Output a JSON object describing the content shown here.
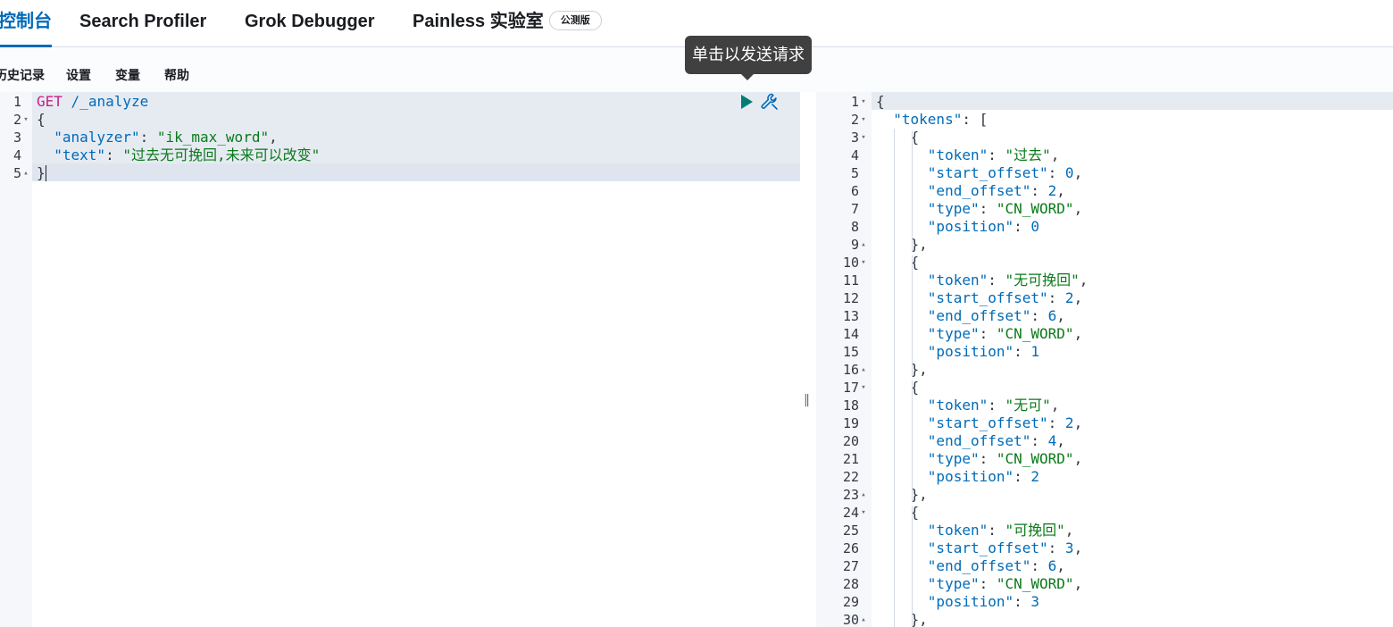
{
  "tabs": [
    {
      "label": "控制台",
      "active": true
    },
    {
      "label": "Search Profiler"
    },
    {
      "label": "Grok Debugger"
    },
    {
      "label": "Painless 实验室",
      "badge": "公测版"
    }
  ],
  "submenu": [
    "历史记录",
    "设置",
    "变量",
    "帮助"
  ],
  "tooltip": "单击以发送请求",
  "request": {
    "lines": [
      {
        "n": "1",
        "fold": "",
        "tokens": [
          [
            "method",
            "GET"
          ],
          [
            "text",
            " "
          ],
          [
            "path",
            "/_analyze"
          ]
        ]
      },
      {
        "n": "2",
        "fold": "▾",
        "tokens": [
          [
            "punc",
            "{"
          ]
        ]
      },
      {
        "n": "3",
        "fold": "",
        "tokens": [
          [
            "text",
            "  "
          ],
          [
            "key",
            "\"analyzer\""
          ],
          [
            "punc",
            ": "
          ],
          [
            "str",
            "\"ik_max_word\""
          ],
          [
            "punc",
            ","
          ]
        ]
      },
      {
        "n": "4",
        "fold": "",
        "tokens": [
          [
            "text",
            "  "
          ],
          [
            "key",
            "\"text\""
          ],
          [
            "punc",
            ": "
          ],
          [
            "str",
            "\"过去无可挽回,未来可以改变\""
          ]
        ]
      },
      {
        "n": "5",
        "fold": "▴",
        "tokens": [
          [
            "punc",
            "}"
          ]
        ]
      }
    ]
  },
  "response": {
    "lines": [
      {
        "n": "1",
        "fold": "▾",
        "tokens": [
          [
            "punc",
            "{"
          ]
        ]
      },
      {
        "n": "2",
        "fold": "▾",
        "tokens": [
          [
            "text",
            "  "
          ],
          [
            "key",
            "\"tokens\""
          ],
          [
            "punc",
            ": ["
          ]
        ]
      },
      {
        "n": "3",
        "fold": "▾",
        "tokens": [
          [
            "text",
            "    "
          ],
          [
            "punc",
            "{"
          ]
        ]
      },
      {
        "n": "4",
        "fold": "",
        "tokens": [
          [
            "text",
            "      "
          ],
          [
            "key",
            "\"token\""
          ],
          [
            "punc",
            ": "
          ],
          [
            "str",
            "\"过去\""
          ],
          [
            "punc",
            ","
          ]
        ]
      },
      {
        "n": "5",
        "fold": "",
        "tokens": [
          [
            "text",
            "      "
          ],
          [
            "key",
            "\"start_offset\""
          ],
          [
            "punc",
            ": "
          ],
          [
            "num",
            "0"
          ],
          [
            "punc",
            ","
          ]
        ]
      },
      {
        "n": "6",
        "fold": "",
        "tokens": [
          [
            "text",
            "      "
          ],
          [
            "key",
            "\"end_offset\""
          ],
          [
            "punc",
            ": "
          ],
          [
            "num",
            "2"
          ],
          [
            "punc",
            ","
          ]
        ]
      },
      {
        "n": "7",
        "fold": "",
        "tokens": [
          [
            "text",
            "      "
          ],
          [
            "key",
            "\"type\""
          ],
          [
            "punc",
            ": "
          ],
          [
            "str",
            "\"CN_WORD\""
          ],
          [
            "punc",
            ","
          ]
        ]
      },
      {
        "n": "8",
        "fold": "",
        "tokens": [
          [
            "text",
            "      "
          ],
          [
            "key",
            "\"position\""
          ],
          [
            "punc",
            ": "
          ],
          [
            "num",
            "0"
          ]
        ]
      },
      {
        "n": "9",
        "fold": "▴",
        "tokens": [
          [
            "text",
            "    "
          ],
          [
            "punc",
            "},"
          ]
        ]
      },
      {
        "n": "10",
        "fold": "▾",
        "tokens": [
          [
            "text",
            "    "
          ],
          [
            "punc",
            "{"
          ]
        ]
      },
      {
        "n": "11",
        "fold": "",
        "tokens": [
          [
            "text",
            "      "
          ],
          [
            "key",
            "\"token\""
          ],
          [
            "punc",
            ": "
          ],
          [
            "str",
            "\"无可挽回\""
          ],
          [
            "punc",
            ","
          ]
        ]
      },
      {
        "n": "12",
        "fold": "",
        "tokens": [
          [
            "text",
            "      "
          ],
          [
            "key",
            "\"start_offset\""
          ],
          [
            "punc",
            ": "
          ],
          [
            "num",
            "2"
          ],
          [
            "punc",
            ","
          ]
        ]
      },
      {
        "n": "13",
        "fold": "",
        "tokens": [
          [
            "text",
            "      "
          ],
          [
            "key",
            "\"end_offset\""
          ],
          [
            "punc",
            ": "
          ],
          [
            "num",
            "6"
          ],
          [
            "punc",
            ","
          ]
        ]
      },
      {
        "n": "14",
        "fold": "",
        "tokens": [
          [
            "text",
            "      "
          ],
          [
            "key",
            "\"type\""
          ],
          [
            "punc",
            ": "
          ],
          [
            "str",
            "\"CN_WORD\""
          ],
          [
            "punc",
            ","
          ]
        ]
      },
      {
        "n": "15",
        "fold": "",
        "tokens": [
          [
            "text",
            "      "
          ],
          [
            "key",
            "\"position\""
          ],
          [
            "punc",
            ": "
          ],
          [
            "num",
            "1"
          ]
        ]
      },
      {
        "n": "16",
        "fold": "▴",
        "tokens": [
          [
            "text",
            "    "
          ],
          [
            "punc",
            "},"
          ]
        ]
      },
      {
        "n": "17",
        "fold": "▾",
        "tokens": [
          [
            "text",
            "    "
          ],
          [
            "punc",
            "{"
          ]
        ]
      },
      {
        "n": "18",
        "fold": "",
        "tokens": [
          [
            "text",
            "      "
          ],
          [
            "key",
            "\"token\""
          ],
          [
            "punc",
            ": "
          ],
          [
            "str",
            "\"无可\""
          ],
          [
            "punc",
            ","
          ]
        ]
      },
      {
        "n": "19",
        "fold": "",
        "tokens": [
          [
            "text",
            "      "
          ],
          [
            "key",
            "\"start_offset\""
          ],
          [
            "punc",
            ": "
          ],
          [
            "num",
            "2"
          ],
          [
            "punc",
            ","
          ]
        ]
      },
      {
        "n": "20",
        "fold": "",
        "tokens": [
          [
            "text",
            "      "
          ],
          [
            "key",
            "\"end_offset\""
          ],
          [
            "punc",
            ": "
          ],
          [
            "num",
            "4"
          ],
          [
            "punc",
            ","
          ]
        ]
      },
      {
        "n": "21",
        "fold": "",
        "tokens": [
          [
            "text",
            "      "
          ],
          [
            "key",
            "\"type\""
          ],
          [
            "punc",
            ": "
          ],
          [
            "str",
            "\"CN_WORD\""
          ],
          [
            "punc",
            ","
          ]
        ]
      },
      {
        "n": "22",
        "fold": "",
        "tokens": [
          [
            "text",
            "      "
          ],
          [
            "key",
            "\"position\""
          ],
          [
            "punc",
            ": "
          ],
          [
            "num",
            "2"
          ]
        ]
      },
      {
        "n": "23",
        "fold": "▴",
        "tokens": [
          [
            "text",
            "    "
          ],
          [
            "punc",
            "},"
          ]
        ]
      },
      {
        "n": "24",
        "fold": "▾",
        "tokens": [
          [
            "text",
            "    "
          ],
          [
            "punc",
            "{"
          ]
        ]
      },
      {
        "n": "25",
        "fold": "",
        "tokens": [
          [
            "text",
            "      "
          ],
          [
            "key",
            "\"token\""
          ],
          [
            "punc",
            ": "
          ],
          [
            "str",
            "\"可挽回\""
          ],
          [
            "punc",
            ","
          ]
        ]
      },
      {
        "n": "26",
        "fold": "",
        "tokens": [
          [
            "text",
            "      "
          ],
          [
            "key",
            "\"start_offset\""
          ],
          [
            "punc",
            ": "
          ],
          [
            "num",
            "3"
          ],
          [
            "punc",
            ","
          ]
        ]
      },
      {
        "n": "27",
        "fold": "",
        "tokens": [
          [
            "text",
            "      "
          ],
          [
            "key",
            "\"end_offset\""
          ],
          [
            "punc",
            ": "
          ],
          [
            "num",
            "6"
          ],
          [
            "punc",
            ","
          ]
        ]
      },
      {
        "n": "28",
        "fold": "",
        "tokens": [
          [
            "text",
            "      "
          ],
          [
            "key",
            "\"type\""
          ],
          [
            "punc",
            ": "
          ],
          [
            "str",
            "\"CN_WORD\""
          ],
          [
            "punc",
            ","
          ]
        ]
      },
      {
        "n": "29",
        "fold": "",
        "tokens": [
          [
            "text",
            "      "
          ],
          [
            "key",
            "\"position\""
          ],
          [
            "punc",
            ": "
          ],
          [
            "num",
            "3"
          ]
        ]
      },
      {
        "n": "30",
        "fold": "▴",
        "tokens": [
          [
            "text",
            "    "
          ],
          [
            "punc",
            "},"
          ]
        ]
      }
    ]
  },
  "colors": {
    "accent": "#006bb8",
    "method": "#c61e82",
    "string": "#0b7a1a",
    "play": "#017d73"
  },
  "icons": {
    "run": "play-icon",
    "request_options": "wrench-icon",
    "resize": "drag-handle-icon"
  }
}
